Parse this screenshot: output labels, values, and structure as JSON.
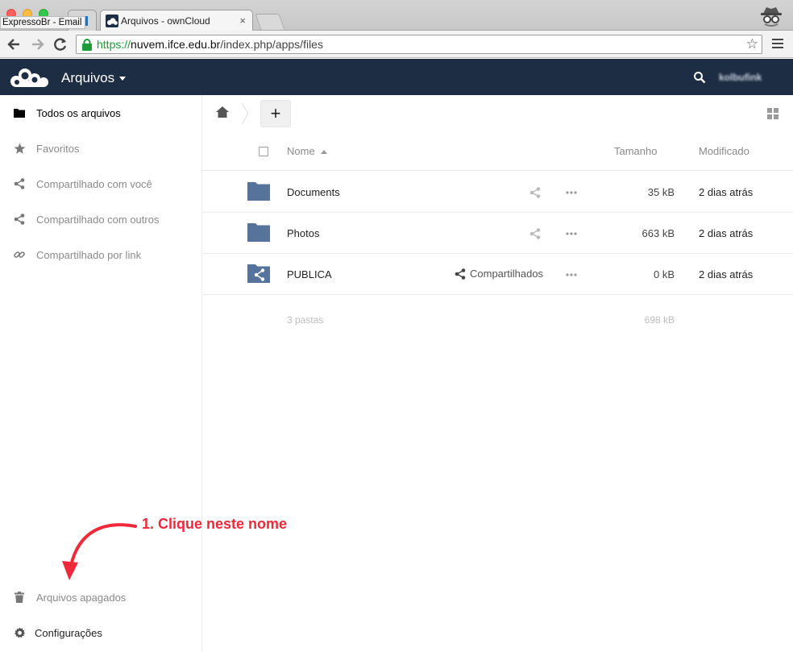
{
  "browser": {
    "tabs": [
      {
        "label": "ExpressoBr - Email"
      },
      {
        "label": "Arquivos - ownCloud"
      }
    ],
    "url_scheme": "https://",
    "url_host": "nuvem.ifce.edu.br",
    "url_path": "/index.php/apps/files"
  },
  "header": {
    "app_title": "Arquivos",
    "user_name": "kolbufink",
    "bg_color": "#1d2d44"
  },
  "sidebar": {
    "items": [
      {
        "label": "Todos os arquivos",
        "icon": "folder-icon"
      },
      {
        "label": "Favoritos",
        "icon": "star-icon"
      },
      {
        "label": "Compartilhado com você",
        "icon": "share-icon"
      },
      {
        "label": "Compartilhado com outros",
        "icon": "share-icon"
      },
      {
        "label": "Compartilhado por link",
        "icon": "link-icon"
      }
    ],
    "deleted": "Arquivos apagados",
    "settings": "Configurações"
  },
  "files": {
    "headers": {
      "name": "Nome",
      "size": "Tamanho",
      "modified": "Modificado"
    },
    "rows": [
      {
        "name": "Documents",
        "size": "35 kB",
        "modified": "2 dias atrás",
        "shared_label": ""
      },
      {
        "name": "Photos",
        "size": "663 kB",
        "modified": "2 dias atrás",
        "shared_label": ""
      },
      {
        "name": "PUBLICA",
        "size": "0 kB",
        "modified": "2 dias atrás",
        "shared_label": "Compartilhados"
      }
    ],
    "summary": {
      "folders": "3 pastas",
      "size": "698 kB"
    },
    "add_label": "+"
  },
  "annotation": {
    "text": "1. Clique neste nome",
    "color": "#f0293a"
  }
}
